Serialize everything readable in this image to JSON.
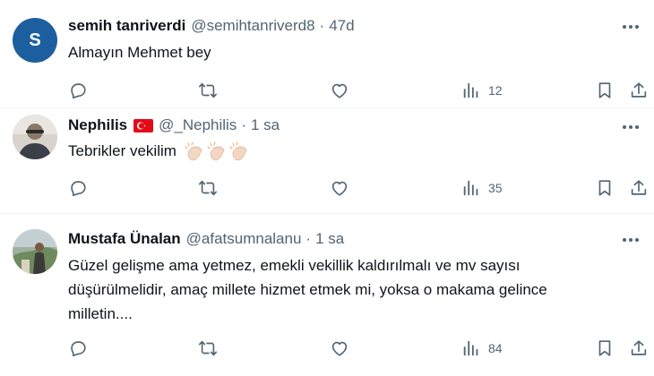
{
  "tweets": [
    {
      "name": "semih tanriverdi",
      "handle": "@semihtanriverd8",
      "separator": "·",
      "time": "47d",
      "avatar_letter": "S",
      "text": "Almayın Mehmet bey",
      "views": "12"
    },
    {
      "name": "Nephilis",
      "handle": "@_Nephilis",
      "separator": "·",
      "time": "1 sa",
      "text": "Tebrikler vekilim",
      "views": "35"
    },
    {
      "name": "Mustafa Ünalan",
      "handle": "@afatsumnalanu",
      "separator": "·",
      "time": "1 sa",
      "text": "Güzel gelişme ama yetmez, emekli vekillik kaldırılmalı ve mv sayısı düşürülmelidir, amaç millete hizmet etmek mi, yoksa o makama gelince milletin....",
      "views": "84"
    }
  ],
  "icons": {
    "reply": "reply-icon",
    "retweet": "retweet-icon",
    "like": "like-icon",
    "views": "views-icon",
    "bookmark": "bookmark-icon",
    "share": "share-icon",
    "more": "more-icon",
    "flag": "turkey-flag-icon",
    "clap": "clapping-hands-emoji"
  },
  "colors": {
    "text": "#0f1419",
    "secondary": "#536471",
    "avatar_s": "#1d5f9e",
    "flag_red": "#e30a17",
    "divider": "#eff3f4"
  }
}
